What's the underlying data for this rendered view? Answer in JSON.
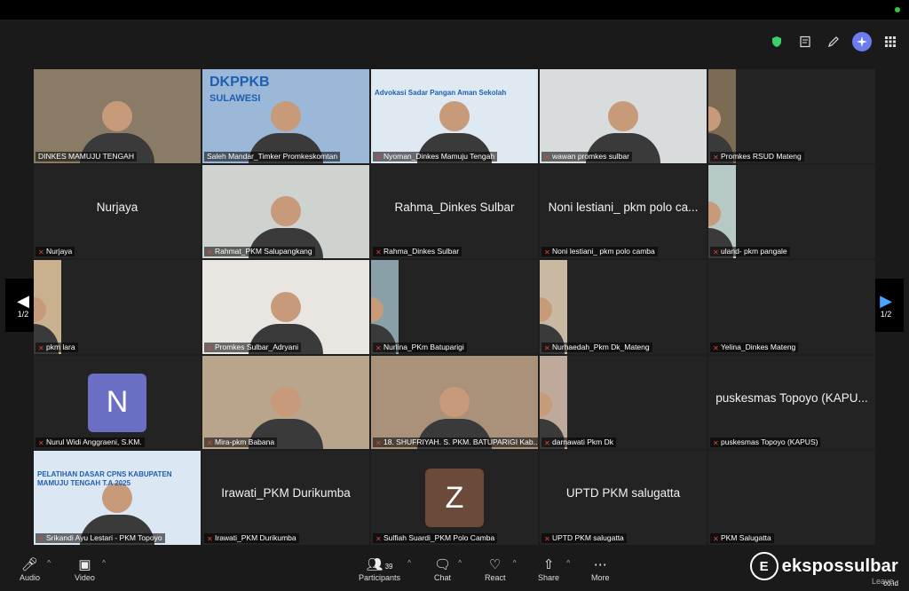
{
  "window": {
    "top_icons": [
      "shield-icon",
      "notes-icon",
      "pencil-icon",
      "ai-companion-icon",
      "apps-grid-icon"
    ]
  },
  "pager": {
    "left_label": "1/2",
    "right_label": "1/2"
  },
  "tiles": [
    {
      "name": "DINKES MAMUJU TENGAH",
      "muted": false,
      "kind": "video",
      "bg": "#8a7b66"
    },
    {
      "name": "Saleh Mandar_Timker Promkeskomtan",
      "muted": false,
      "kind": "video",
      "bg": "#9bb8d8",
      "active": true,
      "banner": "DKPPKB",
      "banner_sub": "SULAWESI"
    },
    {
      "name": "Nyoman_Dinkes Mamuju Tengah",
      "muted": true,
      "kind": "video",
      "bg": "#dfe9f2",
      "banner": "Advokasi Sadar Pangan Aman Sekolah"
    },
    {
      "name": "wawan promkes sulbar",
      "muted": true,
      "kind": "video",
      "bg": "#d9dcdc"
    },
    {
      "name": "Promkes RSUD Mateng",
      "muted": true,
      "kind": "video-narrow",
      "bg": "#7d6a55"
    },
    {
      "name": "Nurjaya",
      "muted": true,
      "kind": "name",
      "display": "Nurjaya"
    },
    {
      "name": "Rahmat_PKM Salupangkang",
      "muted": true,
      "kind": "video",
      "bg": "#cfd3cf"
    },
    {
      "name": "Rahma_Dinkes Sulbar",
      "muted": true,
      "kind": "name",
      "display": "Rahma_Dinkes Sulbar"
    },
    {
      "name": "Noni lestiani_ pkm polo camba",
      "muted": true,
      "kind": "name",
      "display": "Noni lestiani_ pkm polo ca..."
    },
    {
      "name": "uland- pkm pangale",
      "muted": true,
      "kind": "video-narrow",
      "bg": "#b7c9c4"
    },
    {
      "name": "pkm lara",
      "muted": true,
      "kind": "video-narrow",
      "bg": "#c9b08f"
    },
    {
      "name": "Promkes Sulbar_Adryani",
      "muted": true,
      "kind": "video",
      "bg": "#e9e6e2"
    },
    {
      "name": "Nurlina_PKm Batuparigi",
      "muted": true,
      "kind": "video-narrow",
      "bg": "#8aa0a8"
    },
    {
      "name": "Nurhaedah_Pkm Dk_Mateng",
      "muted": true,
      "kind": "video-narrow",
      "bg": "#c9b9a2"
    },
    {
      "name": "Yelina_Dinkes Mateng",
      "muted": true,
      "kind": "empty"
    },
    {
      "name": "Nurul Widi Anggraeni, S.KM.",
      "muted": true,
      "kind": "avatar",
      "initial": "N",
      "avatar_color": "#6a6fc4"
    },
    {
      "name": "Mira-pkm Babana",
      "muted": true,
      "kind": "video",
      "bg": "#b8a58c"
    },
    {
      "name": "18. SHUFRIYAH. S. PKM. BATUPARIGI Kab...",
      "muted": true,
      "kind": "video",
      "bg": "#a9917a"
    },
    {
      "name": "darnawati Pkm Dk",
      "muted": true,
      "kind": "video-narrow",
      "bg": "#bfa99a"
    },
    {
      "name": "puskesmas Topoyo (KAPUS)",
      "muted": true,
      "kind": "name",
      "display": "puskesmas Topoyo (KAPU..."
    },
    {
      "name": "Srikandi Ayu Lestari - PKM Topoyo",
      "muted": true,
      "kind": "video",
      "bg": "#dce7f4",
      "banner": "PELATIHAN DASAR CPNS KABUPATEN MAMUJU TENGAH T.A 2025"
    },
    {
      "name": "Irawati_PKM Durikumba",
      "muted": true,
      "kind": "name",
      "display": "Irawati_PKM Durikumba"
    },
    {
      "name": "Sulfiah Suardi_PKM Polo Camba",
      "muted": true,
      "kind": "avatar",
      "initial": "Z",
      "avatar_color": "#6b4a3a"
    },
    {
      "name": "UPTD PKM salugatta",
      "muted": true,
      "kind": "name",
      "display": "UPTD PKM salugatta"
    },
    {
      "name": "PKM Salugatta",
      "muted": true,
      "kind": "empty"
    }
  ],
  "toolbar": {
    "audio": "Audio",
    "video": "Video",
    "participants": "Participants",
    "participants_count": "39",
    "chat": "Chat",
    "react": "React",
    "share": "Share",
    "more": "More",
    "leave": "Leave"
  },
  "watermark": {
    "text": "ekspossulbar",
    "suffix": "co.id",
    "logo_letter": "E"
  }
}
